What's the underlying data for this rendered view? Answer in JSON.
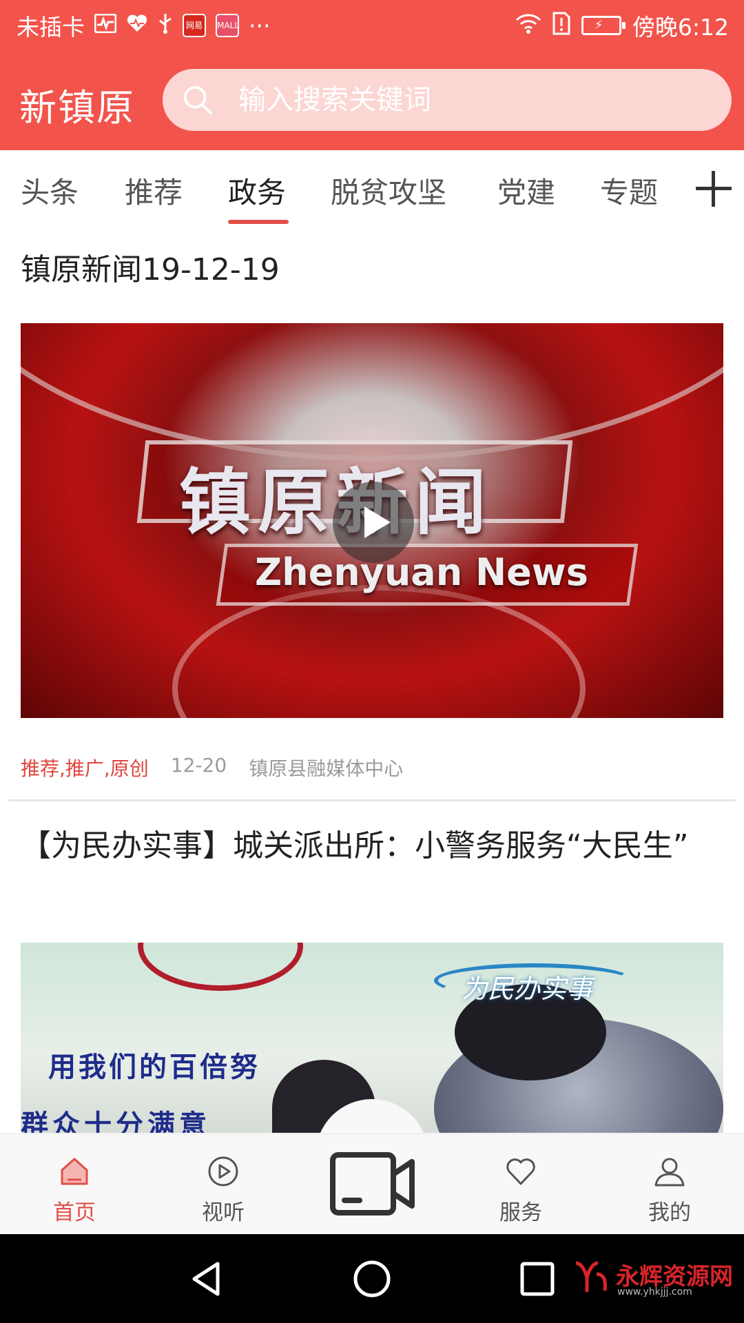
{
  "status_bar": {
    "carrier": "未插卡",
    "more": "···",
    "badge_netease": "网易",
    "badge_mall": "MALL",
    "time": "傍晚6:12"
  },
  "header": {
    "app_title": "新镇原",
    "search_placeholder": "输入搜索关键词",
    "brand_color": "#f2544c"
  },
  "tabs": [
    {
      "label": "头条"
    },
    {
      "label": "推荐"
    },
    {
      "label": "政务",
      "active": true
    },
    {
      "label": "脱贫攻坚"
    },
    {
      "label": "党建"
    },
    {
      "label": "专题"
    }
  ],
  "feed": [
    {
      "title": "镇原新闻19-12-19",
      "thumb_title": "镇原新闻",
      "thumb_subtitle": "Zhenyuan News",
      "tags": "推荐,推广,原创",
      "date": "12-20",
      "source": "镇原县融媒体中心"
    },
    {
      "title": "【为民办实事】城关派出所：小警务服务“大民生”",
      "thumb_banner": "为民办实事",
      "thumb_slogan_1": "用我们的百倍努",
      "thumb_slogan_2": "群众十分满意"
    }
  ],
  "bottom_nav": [
    {
      "label": "首页",
      "icon": "home-icon",
      "active": true
    },
    {
      "label": "视听",
      "icon": "play-circle-icon"
    },
    {
      "label": "",
      "icon": "video-camera-icon"
    },
    {
      "label": "服务",
      "icon": "heart-icon"
    },
    {
      "label": "我的",
      "icon": "user-icon"
    }
  ],
  "watermark": {
    "text": "永辉资源网",
    "url": "www.yhkjjj.com"
  },
  "colors": {
    "accent": "#e14f48",
    "active_tab_underline": "#e14f48",
    "tag_red": "#e0463e"
  }
}
